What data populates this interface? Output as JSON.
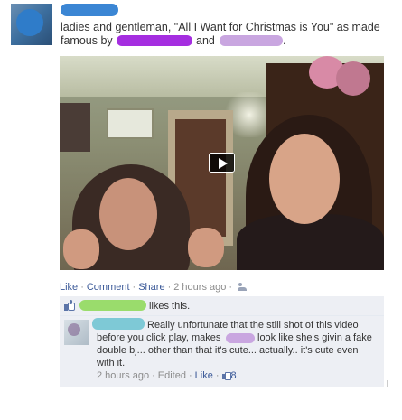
{
  "post": {
    "author_redaction_color": "#3b86d4",
    "text_line1": "ladies and gentleman, \"All I Want for Christmas is You\" as made",
    "text_famous_by": "famous by",
    "text_and": "and",
    "text_period": ".",
    "redaction_colors": {
      "name1": "#a52ee0",
      "name2": "#c9a6e0"
    }
  },
  "video": {
    "play_icon": "play-icon"
  },
  "actions": {
    "like": "Like",
    "comment": "Comment",
    "share": "Share",
    "timestamp": "2 hours ago",
    "separator": "·",
    "audience_icon": "friends-icon"
  },
  "likes": {
    "icon": "thumbs-up-icon",
    "redaction_color": "#9adc6c",
    "text": "likes this."
  },
  "comment": {
    "author_redaction_color": "#7ec9d6",
    "inline_redaction_color": "#c9a6e0",
    "line1": "Really unfortunate that the still shot of this video",
    "line2a": "before you click play, makes",
    "line2b": "look like she's givin a fake",
    "line3": "double bj... other than that it's cute... actually.. it's cute even",
    "line4": "with it.",
    "timestamp": "2 hours ago",
    "edited": "Edited",
    "like": "Like",
    "like_count": "8",
    "separator": "·"
  },
  "colors": {
    "link": "#3b5998",
    "muted": "#8c8c8c",
    "ufi_bg": "#edeff4"
  }
}
